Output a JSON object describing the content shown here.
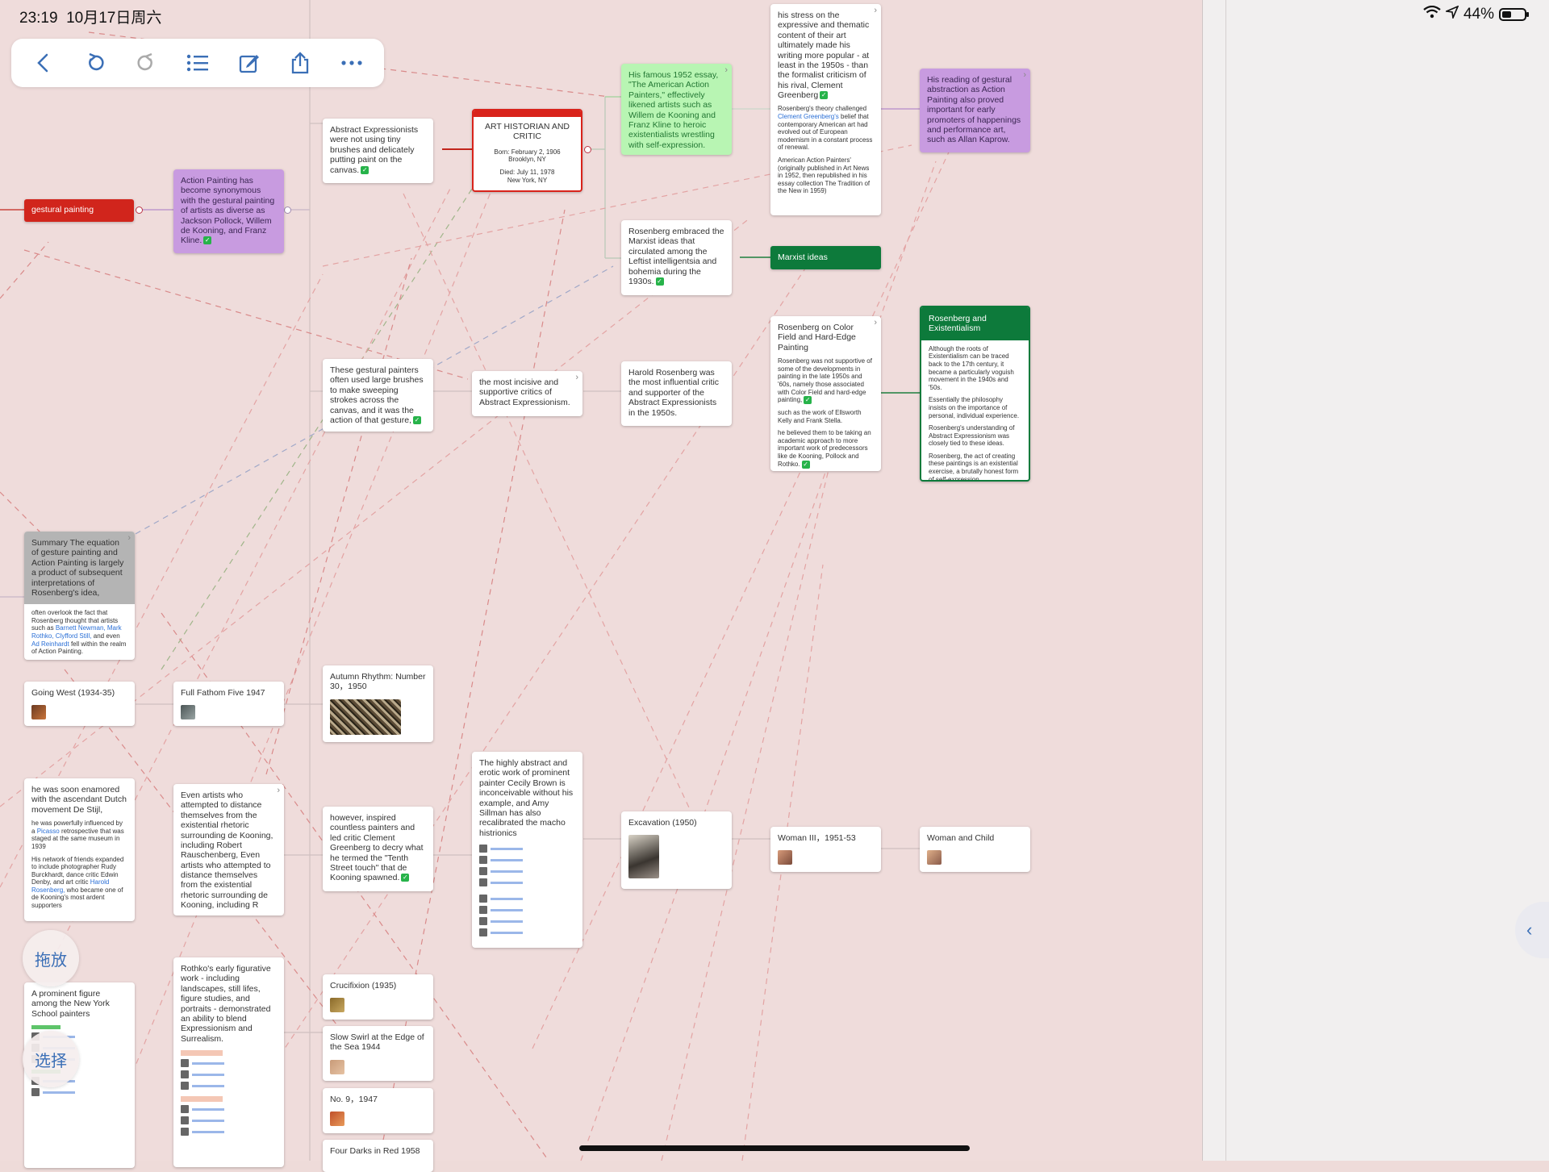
{
  "status": {
    "time": "23:19",
    "date": "10月17日周六",
    "battery_pct": "44%",
    "battery_level": 0.44
  },
  "toolbar": {
    "icons": [
      "back-icon",
      "undo-icon",
      "redo-icon",
      "list-icon",
      "edit-icon",
      "share-icon",
      "more-icon"
    ]
  },
  "colors": {
    "canvas_bg": "#efdcdb",
    "red": "#d1251c",
    "purple": "#c89be0",
    "green": "#0d7a3b",
    "mint": "#b8f5b3",
    "gray": "#b4b4b4"
  },
  "nodes": {
    "gestural": "gestural painting",
    "action_painting": "Action Painting has become synonymous with the gestural painting of artists as diverse as Jackson Pollock, Willem de Kooning, and Franz Kline.",
    "abstract_exp": "Abstract Expressionists were not using tiny brushes and delicately putting paint on the canvas.",
    "historian_title": "ART HISTORIAN AND CRITIC",
    "historian_born": "Born: February 2, 1906\nBrooklyn, NY",
    "historian_died": "Died: July 11, 1978\nNew York, NY",
    "famous_essay": "His famous 1952 essay, \"The American Action Painters,\" effectively likened artists such as Willem de Kooning and Franz Kline to heroic existentialists wrestling with self-expression.",
    "stress": "his stress on the expressive and thematic content of their art ultimately made his writing more popular - at least in the 1950s - than the formalist criticism of his rival, Clement Greenberg",
    "stress_small_a": "Rosenberg's theory challenged",
    "stress_small_link": "Clement Greenberg's",
    "stress_small_b": "belief that contemporary American art had evolved out of European modernism in a constant process of renewal.",
    "stress_small_c": "American Action Painters' (originally published in Art News in 1952, then republished in his essay collection The Tradition of the New in 1959)",
    "reading": "His reading of gestural abstraction as Action Painting also proved important for early promoters of happenings and performance art, such as Allan Kaprow.",
    "marxist_embraced": "Rosenberg embraced the Marxist ideas that circulated among the Leftist intelligentsia and bohemia during the 1930s.",
    "marxist_tag": "Marxist ideas",
    "color_field_title": "Rosenberg on Color Field and Hard-Edge Painting",
    "color_field_a": "Rosenberg was not supportive of some of the developments in painting in the late 1950s and '60s, namely those associated with Color Field and hard-edge painting,",
    "color_field_b": "such as the work of Ellsworth Kelly and Frank Stella.",
    "color_field_c": "he believed them to be taking an academic approach to more important work of predecessors like de Kooning, Pollock and Rothko.",
    "existential_title": "Rosenberg and Existentialism",
    "existential_a": "Although the roots of Existentialism can be traced back to the 17th century, it became a particularly voguish movement in the 1940s and '50s.",
    "existential_b": "Essentially the philosophy insists on the importance of personal, individual experience.",
    "existential_c": "Rosenberg's understanding of Abstract Expressionism was closely tied to these ideas.",
    "existential_d": "Rosenberg, the act of creating these paintings is an existential exercise, a brutally honest form of self-expression.",
    "gestural_painters": "These gestural painters often used large brushes to make sweeping strokes across the canvas, and it was the action of that gesture,",
    "incisive": "the most incisive and supportive critics of Abstract Expressionism.",
    "harold": "Harold Rosenberg was the most influential critic and supporter of the Abstract Expressionists in the 1950s.",
    "summary_head": "Summary The equation of gesture painting and Action Painting is largely a product of subsequent interpretations of Rosenberg's idea,",
    "summary_a": "often overlook the fact that Rosenberg thought that artists such as",
    "summary_links": "Barnett Newman, Mark Rothko, Clyfford Still,",
    "summary_b": "and even",
    "summary_link2": "Ad Reinhardt",
    "summary_c": "fell within the realm of Action Painting.",
    "going_west": "Going West (1934-35)",
    "full_fathom": "Full Fathom Five 1947",
    "autumn": "Autumn Rhythm: Number 30，1950",
    "enamored": "he was soon enamored with the ascendant Dutch movement De Stijl,",
    "enamored_a": "he was powerfully influenced by a",
    "enamored_link": "Picasso",
    "enamored_b": "retrospective that was staged at the same museum in 1939",
    "enamored_c": "His network of friends expanded to include photographer Rudy Burckhardt, dance critic Edwin Denby, and art critic",
    "enamored_link2": "Harold Rosenberg,",
    "enamored_d": "who became one of de Kooning's most ardent supporters",
    "even_artists": "Even artists who attempted to distance themselves from the existential rhetoric surrounding de Kooning, including Robert Rauschenberg, Even artists who attempted to distance themselves from the existential rhetoric surrounding de Kooning, including R",
    "however": "however, inspired countless painters and led critic Clement Greenberg to decry what he termed the \"Tenth Street touch\" that de Kooning spawned.",
    "highly_abstract": "The highly abstract and erotic work of prominent painter Cecily Brown is inconceivable without his example, and Amy Sillman has also recalibrated the macho histrionics",
    "excavation": "Excavation (1950)",
    "woman_iii": "Woman III，1951-53",
    "woman_child": "Woman and Child",
    "prominent": "A prominent figure among the New York School painters",
    "rothko": "Rothko's early figurative work - including landscapes, still lifes, figure studies, and portraits - demonstrated an ability to blend Expressionism and Surrealism.",
    "crucifixion": "Crucifixion (1935)",
    "slow_swirl": "Slow Swirl at the Edge of the Sea 1944",
    "no9": "No. 9，1947",
    "four_darks": "Four Darks in Red 1958"
  },
  "floating": {
    "drag": "拖放",
    "select": "选择"
  }
}
